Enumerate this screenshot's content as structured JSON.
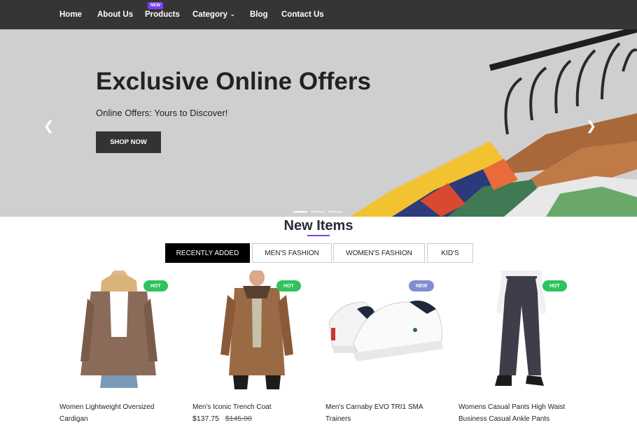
{
  "nav": {
    "items": [
      "Home",
      "About Us",
      "Products",
      "Category",
      "Blog",
      "Contact Us"
    ],
    "products_badge": "NEW"
  },
  "hero": {
    "title": "Exclusive Online Offers",
    "subtitle": "Online Offers: Yours to Discover!",
    "button": "SHOP NOW",
    "prev_icon": "chevron-left-icon",
    "next_icon": "chevron-right-icon",
    "active_slide": 1,
    "slide_count": 3
  },
  "section": {
    "title": "New Items",
    "tabs": [
      "RECENTLY ADDED",
      "MEN'S FASHION",
      "WOMEN'S FASHION",
      "KID'S"
    ],
    "active_tab": 0
  },
  "products": [
    {
      "name": "Women Lightweight Oversized Cardigan",
      "badge": "HOT",
      "price": "",
      "old_price": ""
    },
    {
      "name": "Men's Iconic Trench Coat",
      "badge": "HOT",
      "price": "$137.75",
      "old_price": "$145.00"
    },
    {
      "name": "Men's Carnaby EVO TRI1 SMA Trainers",
      "badge": "NEW",
      "price": "",
      "old_price": ""
    },
    {
      "name": "Womens Casual Pants High Waist Business Casual Ankle Pants",
      "badge": "HOT",
      "price": "",
      "old_price": ""
    }
  ],
  "colors": {
    "nav_bg": "#353535",
    "accent": "#7a3ff2",
    "hot": "#2fc35b",
    "new": "#7f8fd1",
    "hero_bg": "#cfcfcf"
  }
}
